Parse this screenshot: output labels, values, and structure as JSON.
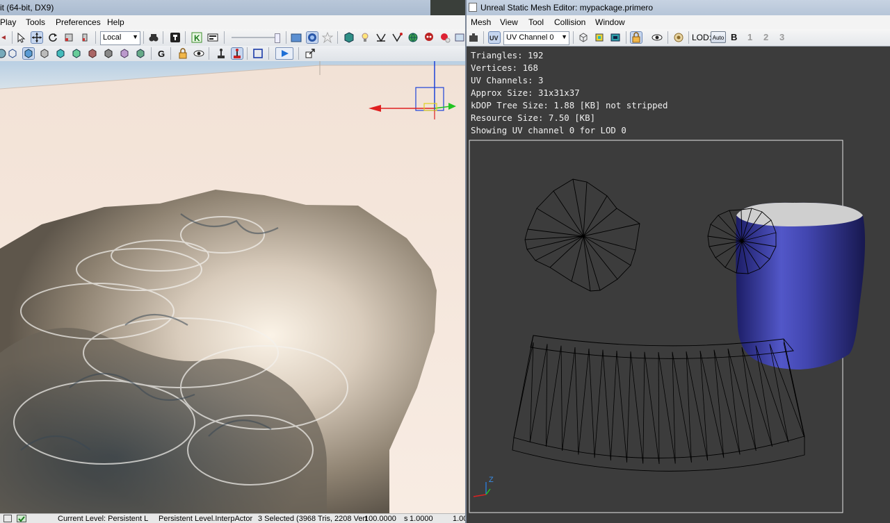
{
  "left_window": {
    "title": "it (64-bit, DX9)",
    "menu": [
      "Play",
      "Tools",
      "Preferences",
      "Help"
    ],
    "coord_system": "Local",
    "status_bar": {
      "current_level": "Current Level:  Persistent L",
      "level_actor": "Persistent Level.InterpActor",
      "selection": "3 Selected (3968 Tris, 2208 Vert",
      "drag_grid": "100.0000",
      "scale": "1.0000",
      "scale_prefix": "s",
      "rotation": "1.00"
    }
  },
  "mesh_editor": {
    "title": "Unreal Static Mesh Editor: mypackage.primero",
    "menu": [
      "Mesh",
      "View",
      "Tool",
      "Collision",
      "Window"
    ],
    "uv_channel": "UV Channel 0",
    "lod_label": "LOD:",
    "lod_auto": "Auto",
    "lod_levels": [
      "B",
      "1",
      "2",
      "3"
    ],
    "stats": [
      "Triangles:  192",
      "Vertices:  168",
      "UV Channels:  3",
      "Approx Size: 31x31x37",
      "kDOP Tree Size: 1.88 [KB] not stripped",
      "Resource Size: 7.50 [KB]",
      "Showing UV channel 0 for LOD 0"
    ],
    "axis_label": "Z"
  },
  "colors": {
    "viewport_bg": "#3c3c3c",
    "mesh_blue": "#3a3fa8",
    "wire": "#000000",
    "stat_text": "#f0f0f0"
  }
}
